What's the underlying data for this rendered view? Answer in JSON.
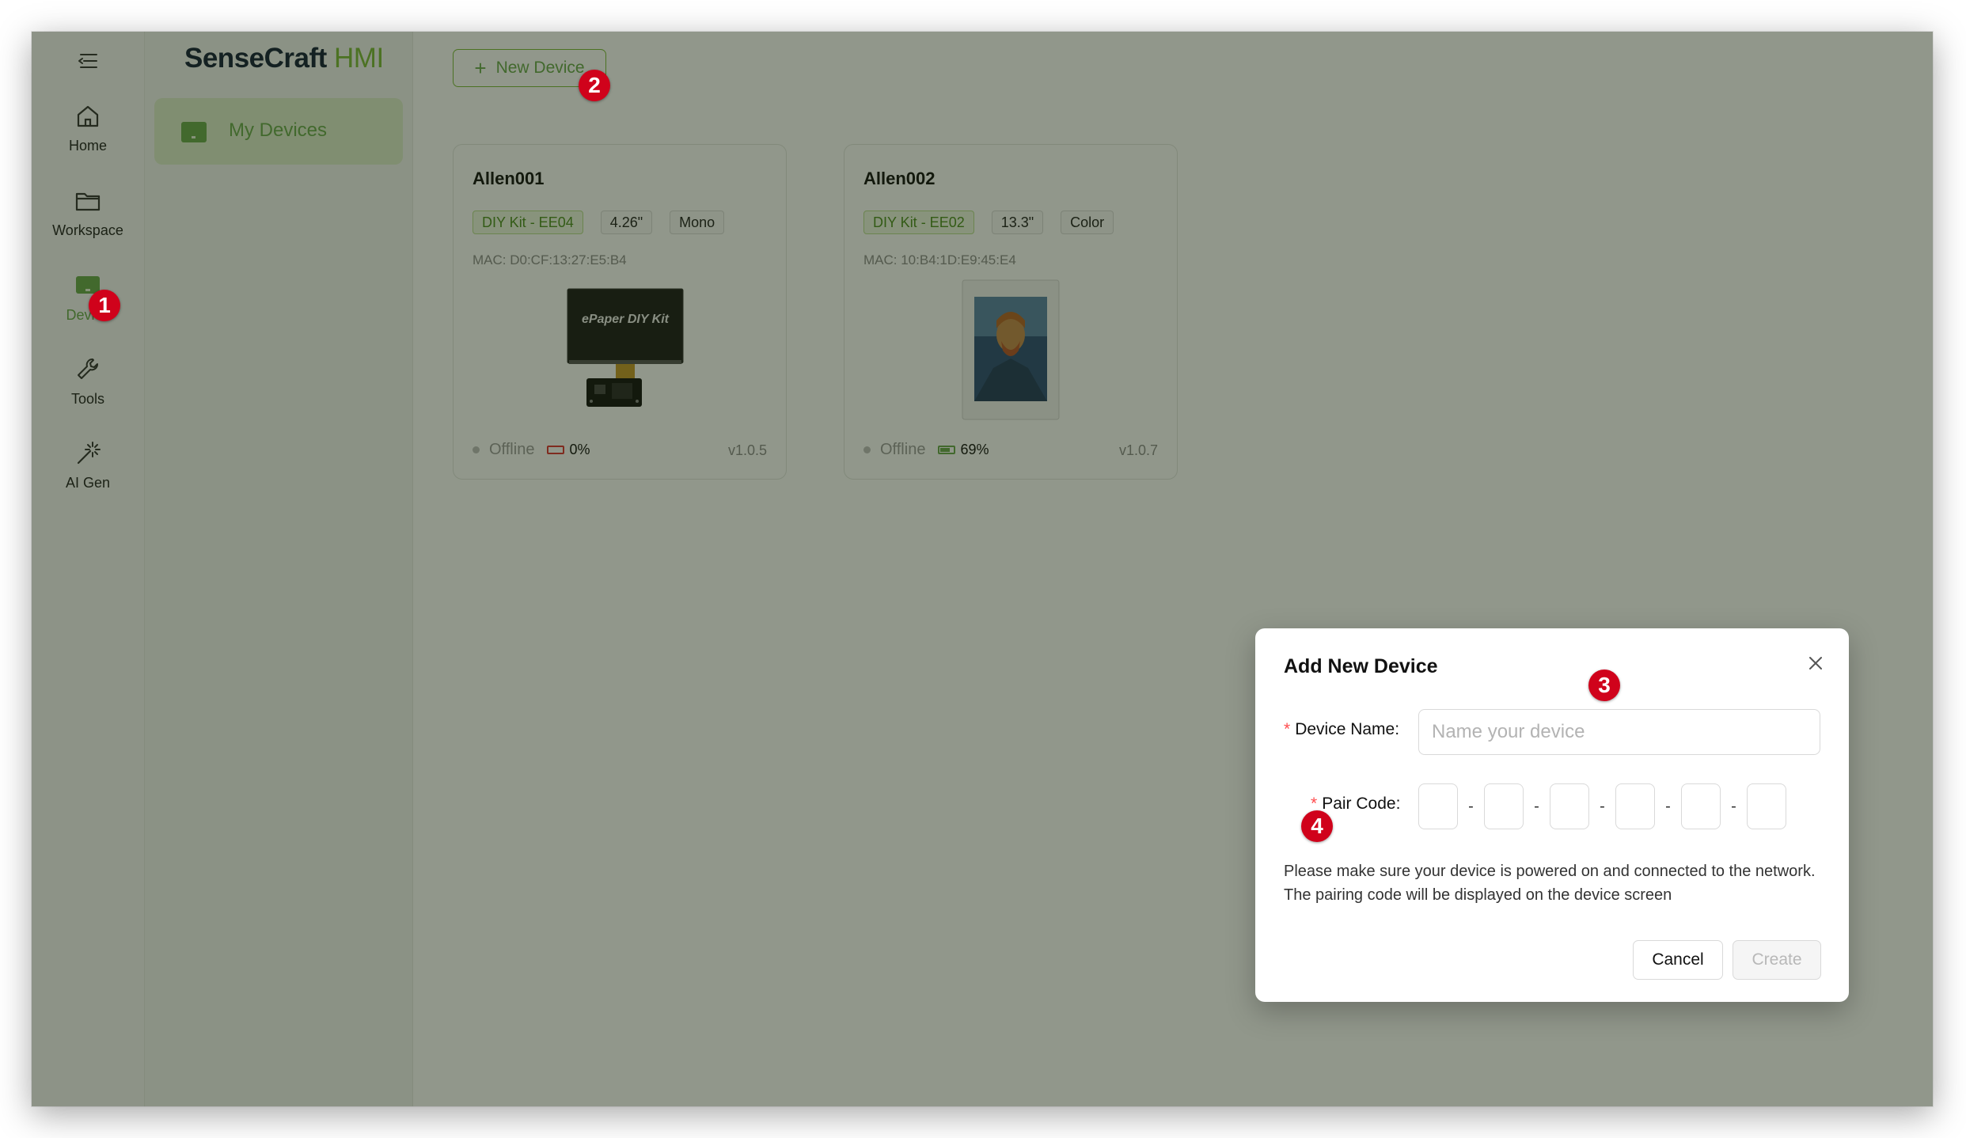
{
  "brand": {
    "name": "SenseCraft",
    "suffix": "HMI"
  },
  "rail": {
    "items": [
      {
        "label": "Home",
        "icon": "home-icon"
      },
      {
        "label": "Workspace",
        "icon": "folder-icon"
      },
      {
        "label": "Device",
        "icon": "device-icon",
        "active": true
      },
      {
        "label": "Tools",
        "icon": "wrench-icon"
      },
      {
        "label": "AI Gen",
        "icon": "magic-wand-icon"
      }
    ]
  },
  "sidebar": {
    "active_item": "My Devices"
  },
  "toolbar": {
    "new_device_label": "New Device"
  },
  "devices": [
    {
      "name": "Allen001",
      "tags": [
        "DIY Kit - EE04",
        "4.26\"",
        "Mono"
      ],
      "mac": "MAC: D0:CF:13:27:E5:B4",
      "status": "Offline",
      "battery": "0%",
      "version": "v1.0.5",
      "image_caption": "ePaper DIY Kit"
    },
    {
      "name": "Allen002",
      "tags": [
        "DIY Kit - EE02",
        "13.3\"",
        "Color"
      ],
      "mac": "MAC: 10:B4:1D:E9:45:E4",
      "status": "Offline",
      "battery": "69%",
      "version": "v1.0.7"
    }
  ],
  "modal": {
    "title": "Add New Device",
    "name_label": "Device Name",
    "name_placeholder": "Name your device",
    "pair_label": "Pair Code",
    "pair_separator": "-",
    "note": "Please make sure your device is powered on and connected to the network. The pairing code will be displayed on the device screen",
    "cancel_label": "Cancel",
    "create_label": "Create"
  },
  "markers": [
    "1",
    "2",
    "3",
    "4"
  ],
  "colors": {
    "accent": "#7dba3c",
    "accent_dark": "#6aa84f",
    "marker": "#d0021b",
    "required": "#ff4d4f",
    "battery_low": "#dd3333"
  }
}
